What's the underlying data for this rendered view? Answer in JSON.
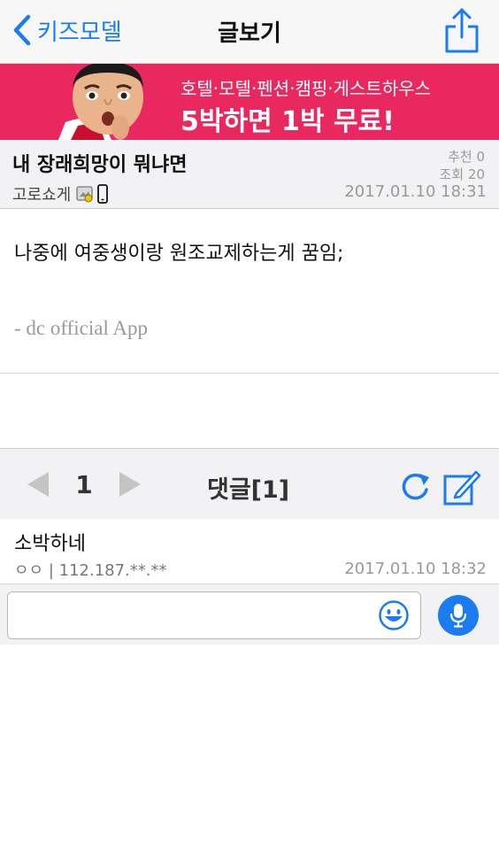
{
  "nav": {
    "back_label": "키즈모델",
    "title": "글보기",
    "icons": {
      "back": "chevron-left-icon",
      "share": "share-icon"
    },
    "accent_color": "#1a7cf0"
  },
  "ad": {
    "line1": "호텔·모텔·펜션·캠핑·게스트하우스",
    "line2": "5박하면 1박 무료!",
    "background_color": "#e8285e"
  },
  "post": {
    "title": "내 장래희망이 뭐냐면",
    "recommend": "추천 0",
    "views": "조회 20",
    "author": "고로쇼게",
    "date": "2017.01.10 18:31",
    "body": "나중에 여중생이랑 원조교제하는게 꿈임;",
    "signature": "- dc official App"
  },
  "comments_toolbar": {
    "page": "1",
    "count_label": "댓글[1]",
    "icons": {
      "prev": "triangle-left-icon",
      "next": "triangle-right-icon",
      "refresh": "refresh-icon",
      "write": "compose-icon"
    }
  },
  "comments": [
    {
      "text": "소박하네",
      "meta": "ㅇㅇ | 112.187.**.**",
      "date": "2017.01.10 18:32"
    }
  ],
  "input": {
    "placeholder": "",
    "icons": {
      "emoji": "smiley-icon",
      "mic": "microphone-icon"
    }
  }
}
